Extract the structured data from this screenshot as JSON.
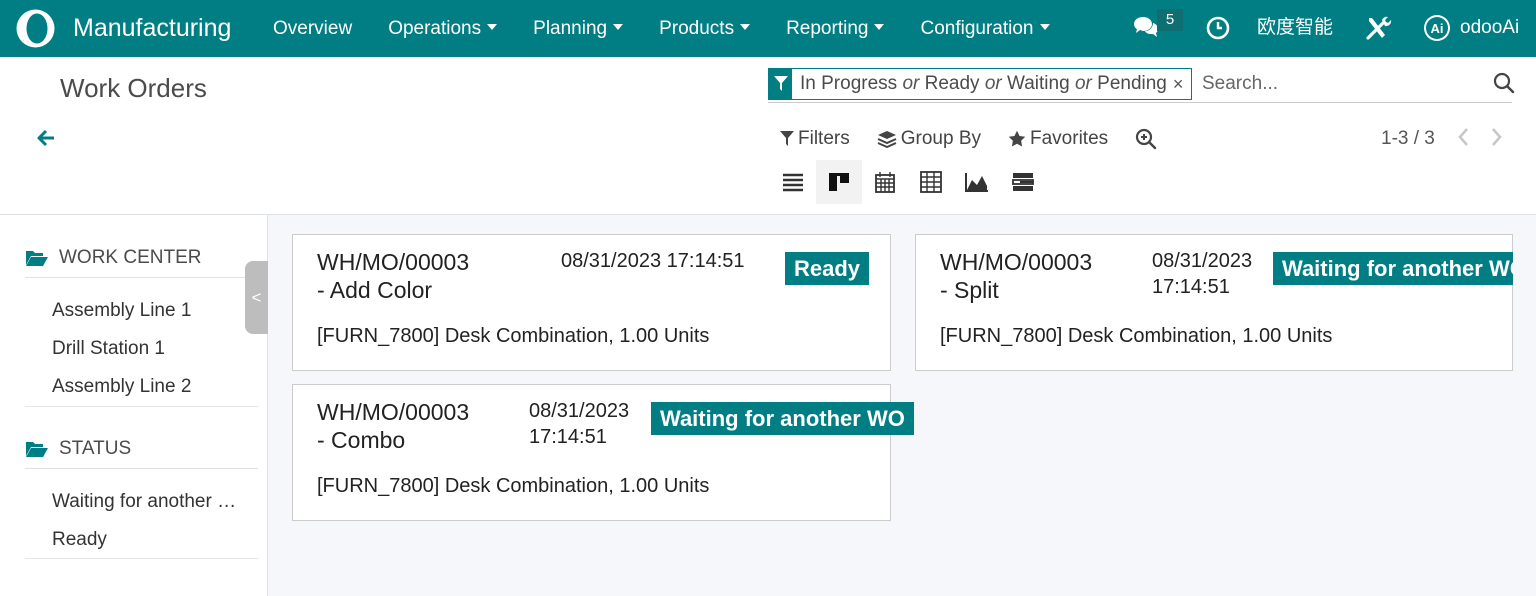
{
  "navbar": {
    "app_name": "Manufacturing",
    "menu": [
      {
        "label": "Overview",
        "dropdown": false
      },
      {
        "label": "Operations",
        "dropdown": true
      },
      {
        "label": "Planning",
        "dropdown": true
      },
      {
        "label": "Products",
        "dropdown": true
      },
      {
        "label": "Reporting",
        "dropdown": true
      },
      {
        "label": "Configuration",
        "dropdown": true
      }
    ],
    "chat_count": "5",
    "company": "欧度智能",
    "user": "odooAi",
    "avatar_text": "Ai",
    "colors": {
      "brand": "#017e84"
    }
  },
  "control": {
    "title": "Work Orders",
    "facet": {
      "values": [
        "In Progress",
        "Ready",
        "Waiting",
        "Pending"
      ],
      "separator": "or",
      "remove": "×"
    },
    "search_placeholder": "Search...",
    "filters_label": "Filters",
    "group_by_label": "Group By",
    "favorites_label": "Favorites",
    "pager": "1-3 / 3",
    "views": [
      "list-icon",
      "kanban-icon",
      "calendar-icon",
      "pivot-icon",
      "graph-icon",
      "gantt-icon"
    ],
    "active_view": "kanban"
  },
  "sidebar": {
    "sections": [
      {
        "title": "WORK CENTER",
        "items": [
          "Assembly Line 1",
          "Drill Station 1",
          "Assembly Line 2"
        ]
      },
      {
        "title": "STATUS",
        "items": [
          "Waiting for another WO",
          "Ready"
        ]
      }
    ],
    "collapse": "<"
  },
  "cards": [
    {
      "title_line1": "WH/MO/00003",
      "title_line2": "- Add Color",
      "date": "08/31/2023 17:14:51",
      "status": "Ready",
      "product": "[FURN_7800] Desk Combination,  1.00 Units"
    },
    {
      "title_line1": "WH/MO/00003",
      "title_line2": "- Split",
      "date_line1": "08/31/2023",
      "date_line2": "17:14:51",
      "status": "Waiting for another WO",
      "product": "[FURN_7800] Desk Combination,  1.00 Units"
    },
    {
      "title_line1": "WH/MO/00003",
      "title_line2": "- Combo",
      "date_line1": "08/31/2023",
      "date_line2": "17:14:51",
      "status": "Waiting for another WO",
      "product": "[FURN_7800] Desk Combination,  1.00 Units"
    }
  ]
}
